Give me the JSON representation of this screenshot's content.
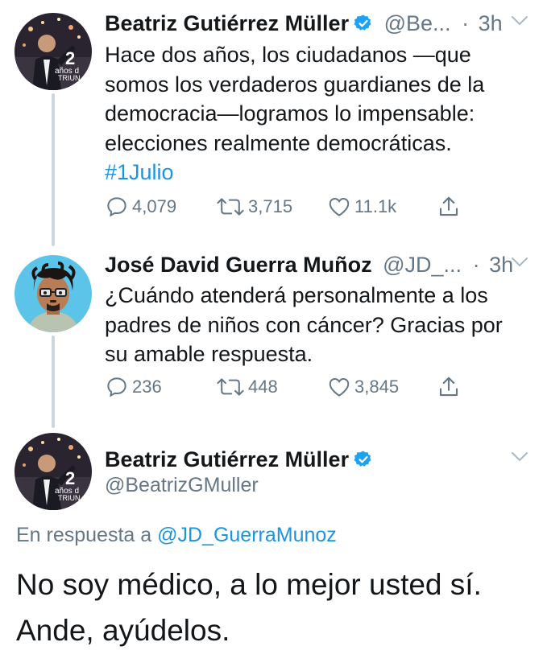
{
  "tweet1": {
    "name": "Beatriz Gutiérrez Müller",
    "handle": "@Be...",
    "separator": "·",
    "time": "3h",
    "text_lines": [
      "Hace dos años, los ciudadanos —que",
      "somos los verdaderos guardianes de la",
      "democracia—logramos lo impensable:",
      "elecciones realmente democráticas."
    ],
    "hashtag": "#1Julio",
    "replies": "4,079",
    "retweets": "3,715",
    "likes": "11.1k",
    "avatar_badge_number": "2",
    "avatar_badge_text": "años d",
    "avatar_badge_text2": "TRIUN"
  },
  "tweet2": {
    "name": "José David Guerra Muñoz",
    "handle": "@JD_...",
    "separator": "·",
    "time": "3h",
    "text_lines": [
      "¿Cuándo atenderá personalmente a los",
      "padres de niños con cáncer? Gracias por",
      "su amable respuesta."
    ],
    "replies": "236",
    "retweets": "448",
    "likes": "3,845"
  },
  "tweet3": {
    "name": "Beatriz Gutiérrez Müller",
    "handle": "@BeatrizGMuller",
    "reply_prefix": "En respuesta a",
    "reply_handle": "@JD_GuerraMunoz",
    "text_lines": [
      "No soy médico, a lo mejor usted sí.",
      "Ande, ayúdelos."
    ],
    "avatar_badge_number": "2",
    "avatar_badge_text": "años d",
    "avatar_badge_text2": "TRIUN"
  },
  "colors": {
    "accent": "#1b95e0",
    "verified": "#1da1f2",
    "muted": "#657786",
    "thread_line": "#ccd6dd"
  },
  "icons": [
    "verified-badge-icon",
    "chevron-down-icon",
    "reply-icon",
    "retweet-icon",
    "like-icon",
    "share-icon"
  ]
}
